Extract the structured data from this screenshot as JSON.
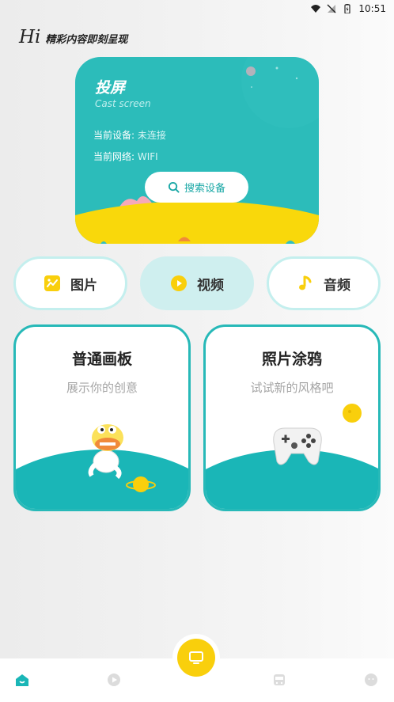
{
  "status": {
    "time": "10:51"
  },
  "greeting": {
    "hi": "Hi",
    "subtitle": "精彩内容即刻呈现"
  },
  "cast": {
    "title": "投屏",
    "subtitle": "Cast screen",
    "device_label": "当前设备:",
    "device_value": " 未连接",
    "network_label": "当前网络:",
    "network_value": " WIFI",
    "search_label": "搜索设备"
  },
  "categories": [
    {
      "label": "图片",
      "icon": "picture-icon",
      "active": false
    },
    {
      "label": "视频",
      "icon": "play-icon",
      "active": true
    },
    {
      "label": "音频",
      "icon": "music-note-icon",
      "active": false
    }
  ],
  "features": [
    {
      "title": "普通画板",
      "subtitle": "展示你的创意"
    },
    {
      "title": "照片涂鸦",
      "subtitle": "试试新的风格吧"
    }
  ],
  "colors": {
    "teal": "#2cbcba",
    "yellow": "#f9cf0c",
    "border": "#27b9b8"
  },
  "nav": {
    "items": [
      "home-icon",
      "play-circle-icon",
      "tv-icon",
      "bus-icon",
      "face-icon"
    ],
    "active": "home-icon"
  }
}
